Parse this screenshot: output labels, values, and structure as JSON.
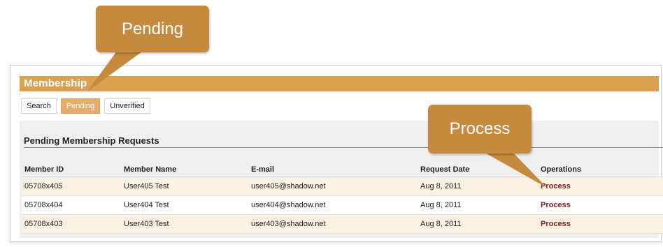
{
  "section": {
    "title": "Membership"
  },
  "tabs": [
    {
      "label": "Search",
      "active": false
    },
    {
      "label": "Pending",
      "active": true
    },
    {
      "label": "Unverified",
      "active": false
    }
  ],
  "requests": {
    "heading": "Pending Membership Requests",
    "columns": [
      "Member ID",
      "Member Name",
      "E-mail",
      "Request Date",
      "Operations"
    ],
    "rows": [
      {
        "member_id": "05708x405",
        "name": "User405 Test",
        "email": "user405@shadow.net",
        "date": "Aug 8, 2011",
        "operation": "Process"
      },
      {
        "member_id": "05708x404",
        "name": "User404 Test",
        "email": "user404@shadow.net",
        "date": "Aug 8, 2011",
        "operation": "Process"
      },
      {
        "member_id": "05708x403",
        "name": "User403 Test",
        "email": "user403@shadow.net",
        "date": "Aug 8, 2011",
        "operation": "Process"
      }
    ]
  },
  "callouts": {
    "pending": "Pending",
    "process": "Process"
  },
  "colors": {
    "accent": "#d9a150",
    "callout": "#c68a3f",
    "active_tab": "#e4ad6e",
    "link": "#7a1f1f"
  }
}
